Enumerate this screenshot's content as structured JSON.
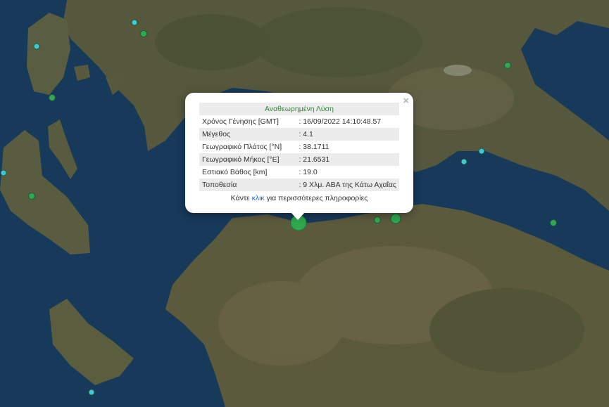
{
  "popup": {
    "title": "Αναθεωρημένη Λύση",
    "close_symbol": "×",
    "rows": [
      {
        "label": "Χρόνος Γένησης [GMT]",
        "value": ": 16/09/2022 14:10:48.57"
      },
      {
        "label": "Μέγεθος",
        "value": ": 4.1"
      },
      {
        "label": "Γεωγραφικό Πλάτος [°N]",
        "value": ": 38.1711"
      },
      {
        "label": "Γεωγραφικό Μήκος [°E]",
        "value": ": 21.6531"
      },
      {
        "label": "Εστιακό Βάθος [km]",
        "value": ": 19.0"
      },
      {
        "label": "Τοποθεσία",
        "value": ": 9 Χλμ. ΑΒΑ της Κάτω Αχαΐας"
      }
    ],
    "more_prefix": "Κάντε",
    "more_link": "κλικ",
    "more_suffix": "για περισσότερες πληροφορίες"
  },
  "colors": {
    "sea": "#17395a",
    "land": "#5a5a3e",
    "marker_green": "#2fa84f",
    "marker_cyan": "#3ec8d8",
    "popup_title": "#2e8b3a",
    "link": "#1a6fc4"
  },
  "markers": [
    {
      "name": "selected-quake-marker",
      "kind": "green",
      "selected": true
    },
    {
      "name": "quake-marker-green",
      "kind": "green"
    },
    {
      "name": "quake-marker-green",
      "kind": "green"
    },
    {
      "name": "quake-marker-green",
      "kind": "green"
    },
    {
      "name": "quake-marker-green",
      "kind": "green"
    },
    {
      "name": "quake-marker-green",
      "kind": "green"
    },
    {
      "name": "quake-marker-green",
      "kind": "green"
    },
    {
      "name": "quake-marker-green",
      "kind": "green"
    },
    {
      "name": "quake-marker-cyan",
      "kind": "cyan"
    },
    {
      "name": "quake-marker-cyan",
      "kind": "cyan"
    },
    {
      "name": "quake-marker-cyan",
      "kind": "cyan"
    },
    {
      "name": "quake-marker-cyan",
      "kind": "cyan"
    },
    {
      "name": "quake-marker-cyan",
      "kind": "cyan"
    },
    {
      "name": "quake-marker-cyan",
      "kind": "cyan"
    }
  ]
}
